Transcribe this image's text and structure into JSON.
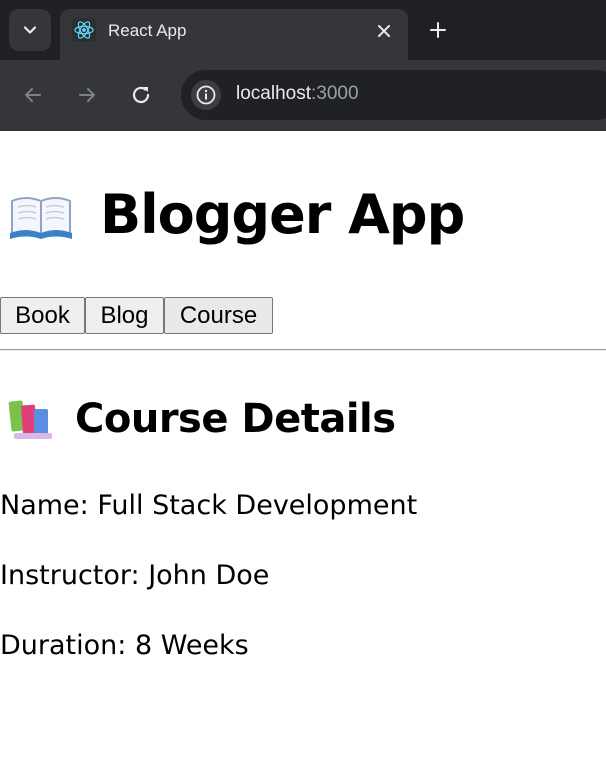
{
  "browser": {
    "tab": {
      "title": "React App",
      "favicon": "react-logo-icon"
    },
    "address": {
      "host": "localhost",
      "port": ":3000"
    },
    "icons": {
      "tab_search": "chevron-down-icon",
      "close_tab": "close-icon",
      "new_tab": "plus-icon",
      "back": "arrow-left-icon",
      "forward": "arrow-right-icon",
      "reload": "reload-icon",
      "site_info": "info-icon"
    },
    "colors": {
      "frame": "#202124",
      "toolbar": "#35363a",
      "text": "#e8eaed"
    }
  },
  "app": {
    "title": "Blogger App",
    "title_icon": "open-book-emoji",
    "nav": [
      {
        "label": "Book"
      },
      {
        "label": "Blog"
      },
      {
        "label": "Course"
      }
    ]
  },
  "course": {
    "heading": "Course Details",
    "heading_icon": "books-emoji",
    "name": "Name: Full Stack Development",
    "instructor": "Instructor: John Doe",
    "duration": "Duration: 8 Weeks"
  }
}
